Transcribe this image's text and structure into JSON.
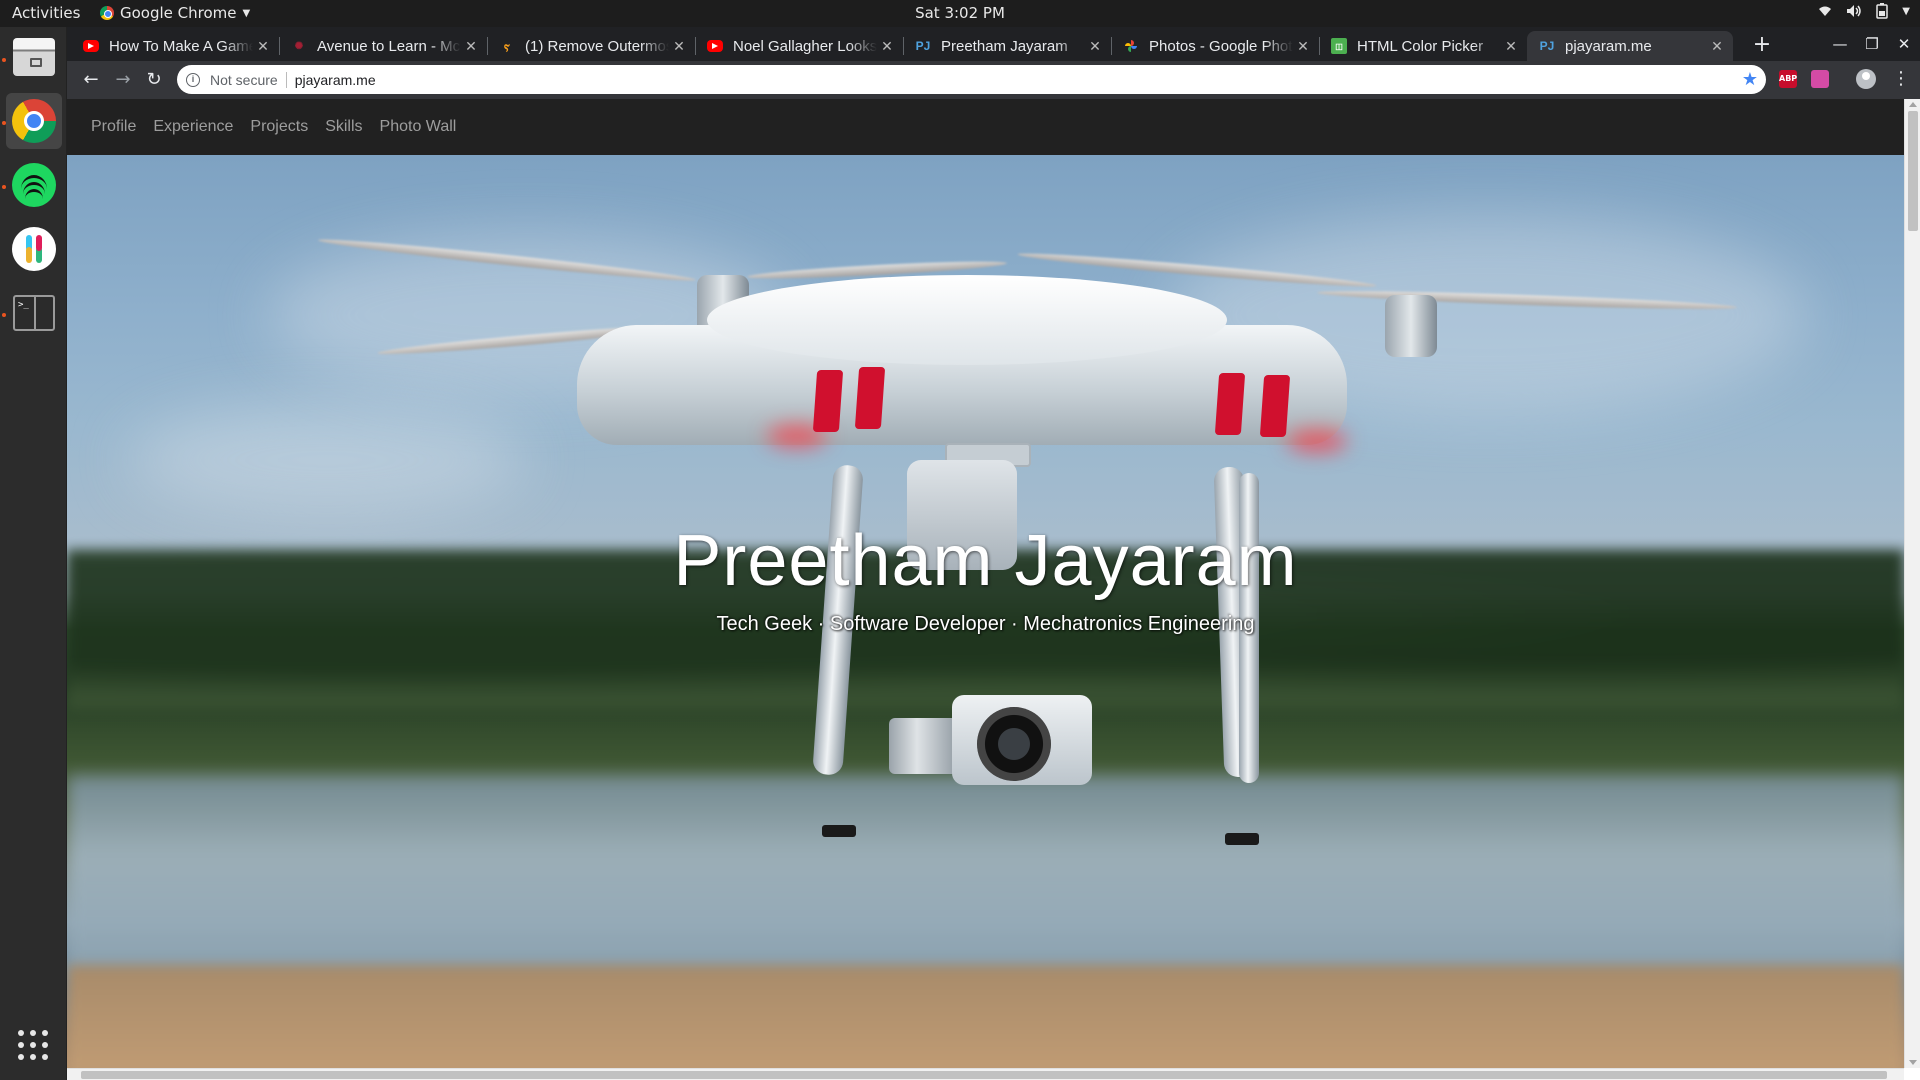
{
  "system": {
    "activities": "Activities",
    "app_name": "Google Chrome",
    "clock": "Sat  3:02 PM"
  },
  "browser": {
    "tabs": [
      {
        "title": "How To Make A Game",
        "icon": "youtube-icon",
        "active": false
      },
      {
        "title": "Avenue to Learn - Mc",
        "icon": "avenue-icon",
        "active": false
      },
      {
        "title": "(1) Remove Outermost",
        "icon": "leetcode-icon",
        "active": false
      },
      {
        "title": "Noel Gallagher Looks",
        "icon": "youtube-icon",
        "active": false
      },
      {
        "title": "Preetham Jayaram",
        "icon": "pj-icon",
        "active": false
      },
      {
        "title": "Photos - Google Photos",
        "icon": "google-photos-icon",
        "active": false
      },
      {
        "title": "HTML Color Picker",
        "icon": "color-picker-icon",
        "active": false
      },
      {
        "title": "pjayaram.me",
        "icon": "pj-icon",
        "active": true
      }
    ],
    "omnibox": {
      "security": "Not secure",
      "url": "pjayaram.me"
    },
    "extensions": [
      {
        "label": "ABP",
        "color": "#c70d2c"
      },
      {
        "label": "",
        "color": "#d44ba5"
      }
    ]
  },
  "site": {
    "nav": [
      "Profile",
      "Experience",
      "Projects",
      "Skills",
      "Photo Wall"
    ],
    "hero": {
      "title": "Preetham Jayaram",
      "subtitle": "Tech Geek · Software Developer · Mechatronics Engineering"
    }
  }
}
